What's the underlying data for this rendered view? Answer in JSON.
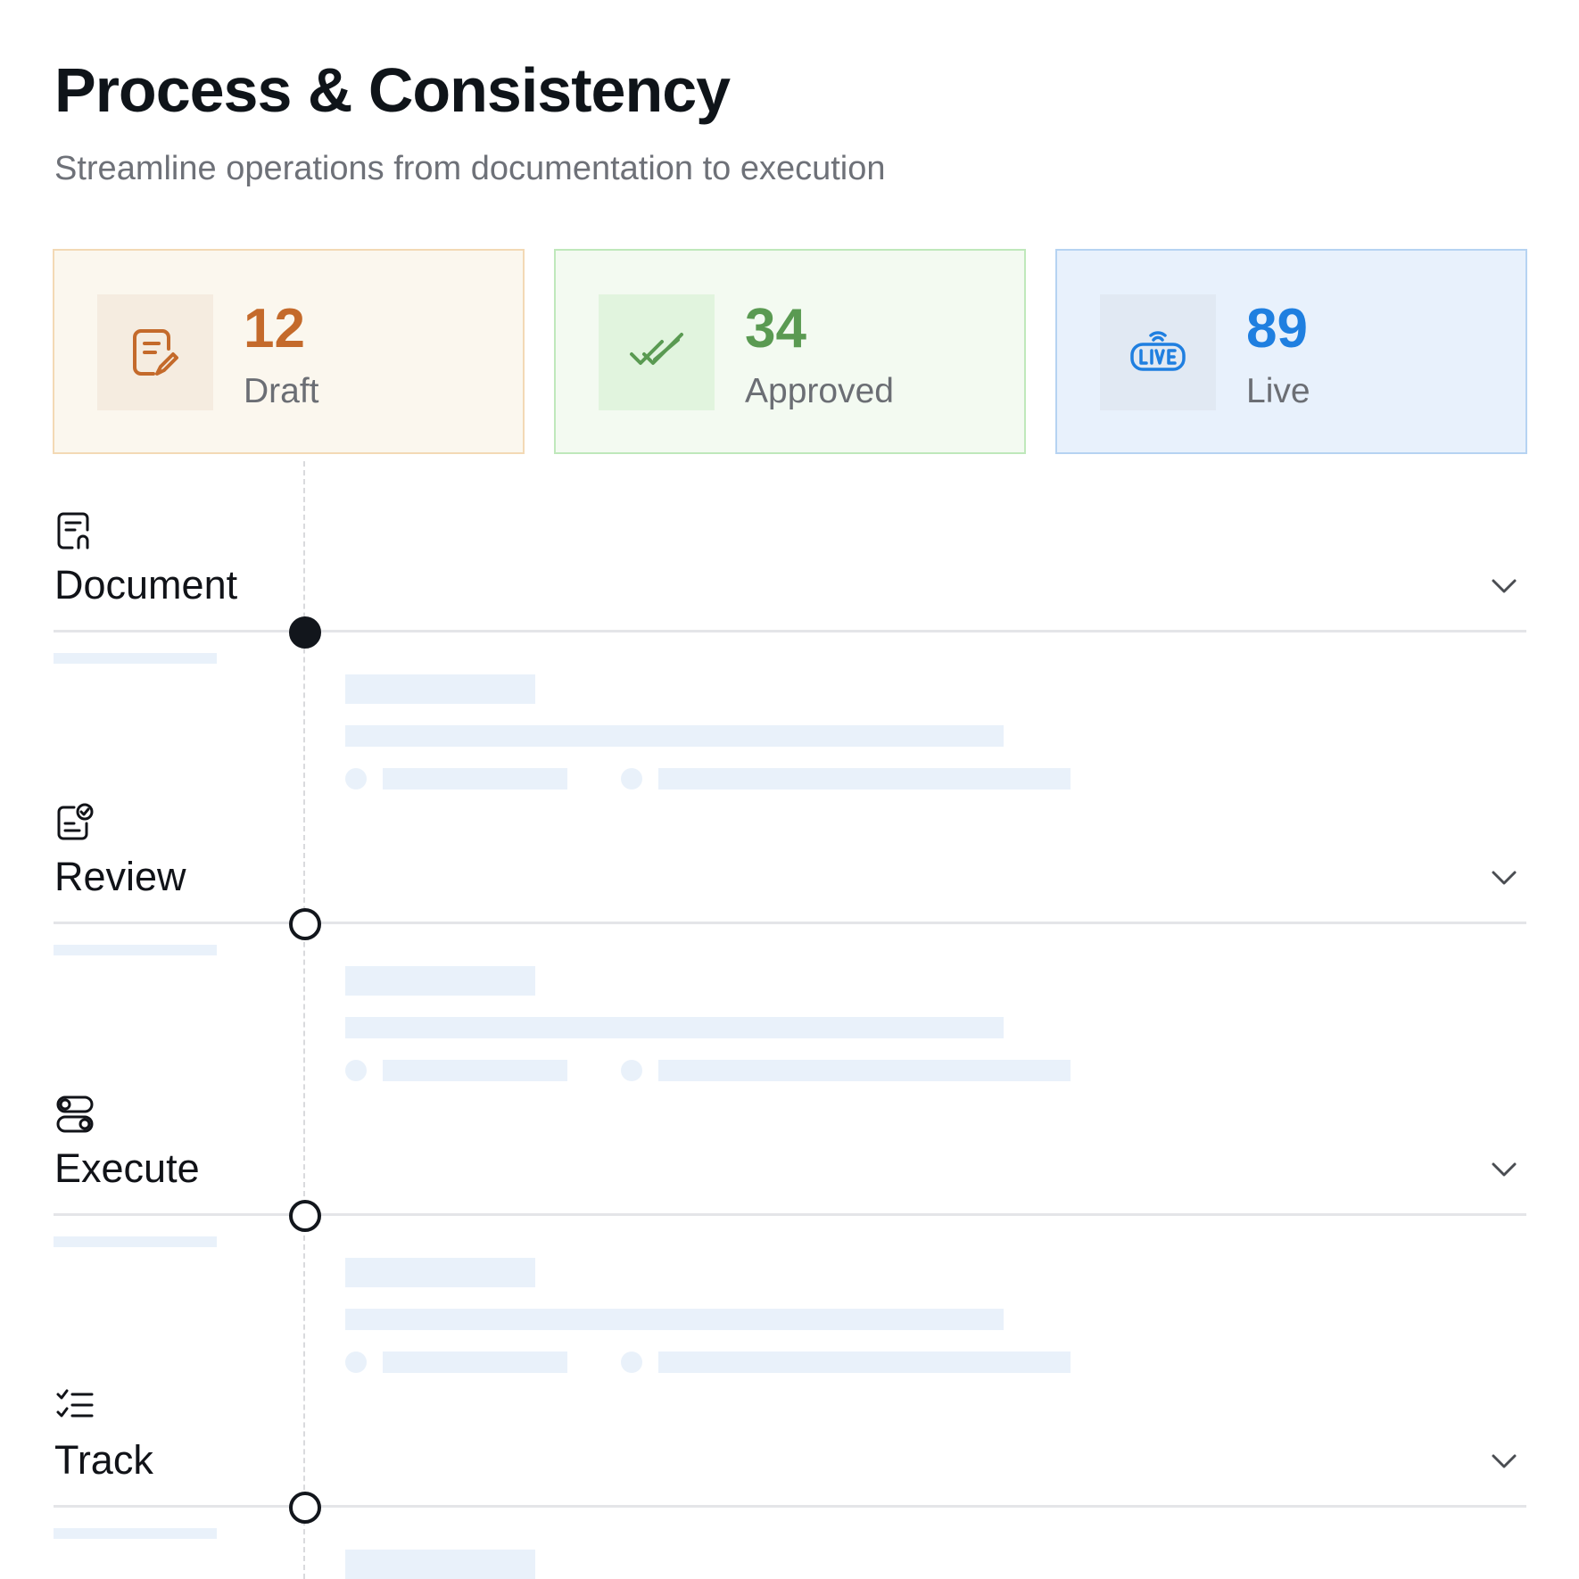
{
  "header": {
    "title": "Process & Consistency",
    "subtitle": "Streamline operations from documentation to execution"
  },
  "stats": [
    {
      "value": "12",
      "label": "Draft",
      "icon": "draft-edit-icon",
      "accent": "#c46a2b",
      "bg": "#fbf7ee",
      "border": "#f3d9b5",
      "icon_bg": "#f5ece0"
    },
    {
      "value": "34",
      "label": "Approved",
      "icon": "double-check-icon",
      "accent": "#5a9a52",
      "bg": "#f3faf1",
      "border": "#bfe8bb",
      "icon_bg": "#e1f4de"
    },
    {
      "value": "89",
      "label": "Live",
      "icon": "live-broadcast-icon",
      "accent": "#1f7fe0",
      "bg": "#e8f1fc",
      "border": "#b6d3f2",
      "icon_bg": "#e1e9f3"
    }
  ],
  "steps": [
    {
      "title": "Document",
      "icon": "document-icon",
      "state": "active"
    },
    {
      "title": "Review",
      "icon": "review-checklist-icon",
      "state": "inactive"
    },
    {
      "title": "Execute",
      "icon": "toggle-switches-icon",
      "state": "inactive"
    },
    {
      "title": "Track",
      "icon": "checklist-icon",
      "state": "inactive"
    }
  ],
  "icons": {
    "chevron": "chevron-down-icon"
  },
  "colors": {
    "skeleton": "#e9f1fa",
    "divider": "#e4e5e8",
    "text": "#111318",
    "muted": "#6e7178"
  }
}
